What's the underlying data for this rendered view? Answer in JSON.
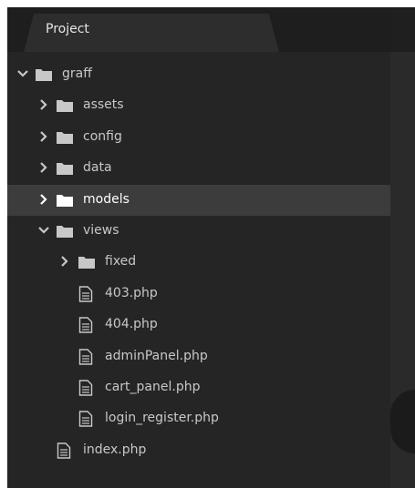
{
  "panel": {
    "tab_label": "Project"
  },
  "tree": [
    {
      "label": "graff",
      "type": "folder",
      "level": 0,
      "expanded": true,
      "selected": false
    },
    {
      "label": "assets",
      "type": "folder",
      "level": 1,
      "expanded": false,
      "selected": false
    },
    {
      "label": "config",
      "type": "folder",
      "level": 1,
      "expanded": false,
      "selected": false
    },
    {
      "label": "data",
      "type": "folder",
      "level": 1,
      "expanded": false,
      "selected": false
    },
    {
      "label": "models",
      "type": "folder",
      "level": 1,
      "expanded": false,
      "selected": true
    },
    {
      "label": "views",
      "type": "folder",
      "level": 1,
      "expanded": true,
      "selected": false
    },
    {
      "label": "fixed",
      "type": "folder",
      "level": 2,
      "expanded": false,
      "selected": false
    },
    {
      "label": "403.php",
      "type": "file",
      "level": 2,
      "selected": false
    },
    {
      "label": "404.php",
      "type": "file",
      "level": 2,
      "selected": false
    },
    {
      "label": "adminPanel.php",
      "type": "file",
      "level": 2,
      "selected": false
    },
    {
      "label": "cart_panel.php",
      "type": "file",
      "level": 2,
      "selected": false
    },
    {
      "label": "login_register.php",
      "type": "file",
      "level": 2,
      "selected": false
    },
    {
      "label": "index.php",
      "type": "file",
      "level": 1,
      "selected": false
    }
  ],
  "icons": {
    "folder": "folder-icon",
    "file": "file-icon",
    "collapsed": "chevron-right-icon",
    "expanded": "chevron-down-icon"
  },
  "colors": {
    "panel_bg": "#252526",
    "selected_bg": "#3c3c3c",
    "text": "#c8c8c8",
    "selected_text": "#ffffff",
    "icon": "#c8c8c8"
  }
}
